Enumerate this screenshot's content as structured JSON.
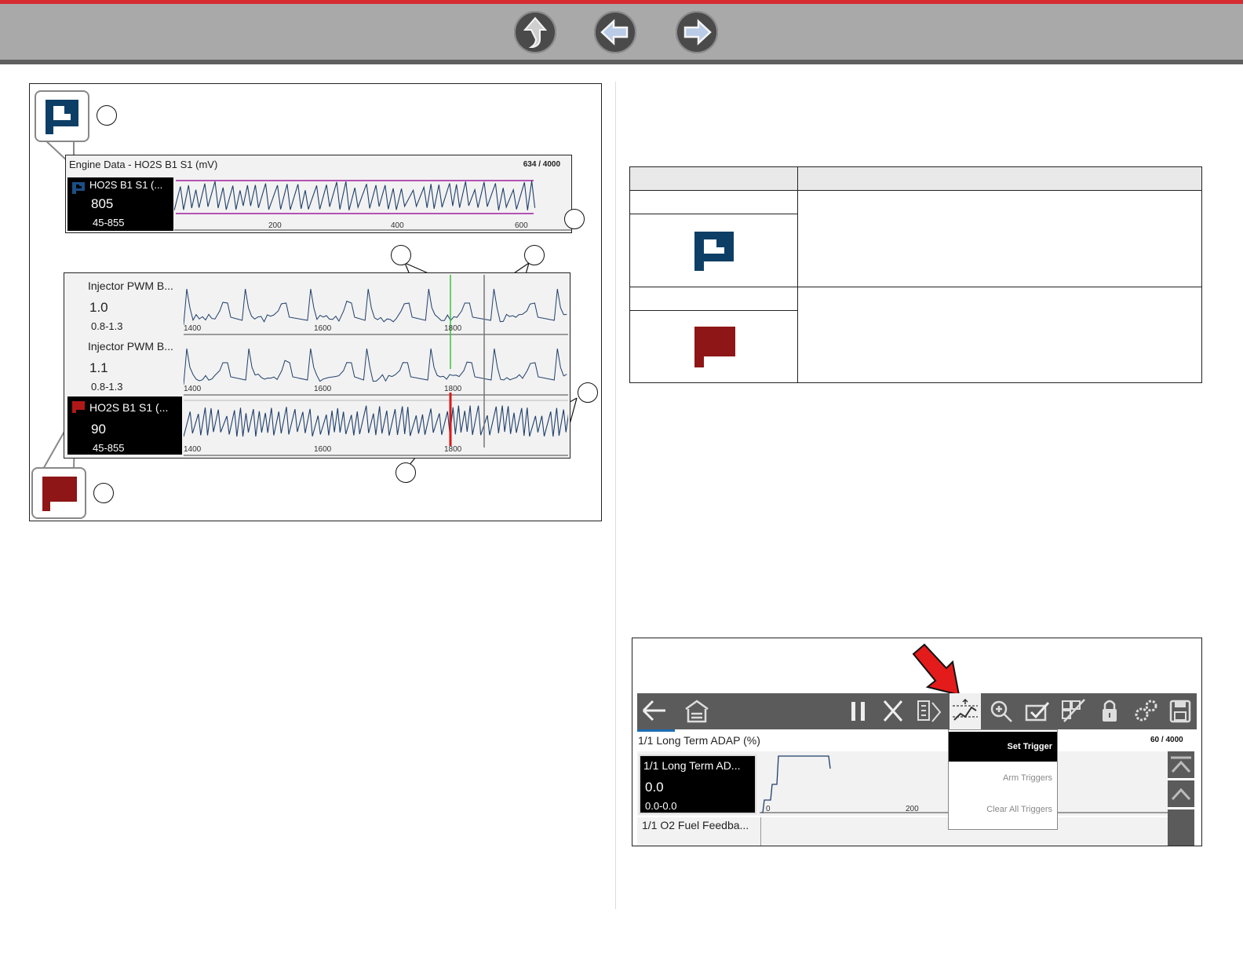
{
  "colors": {
    "brand_red": "#d72a31",
    "flag_blue": "#0d3f66",
    "flag_red": "#8e1616",
    "trace_blue": "#1f3f6b",
    "limit_magenta": "#a020a0",
    "cursor_green": "#3fbf3f",
    "trigger_red": "#d61a1a"
  },
  "nav": {
    "icons": [
      "up-arrow-icon",
      "back-arrow-icon",
      "forward-arrow-icon"
    ]
  },
  "figure1": {
    "top_graph": {
      "title": "Engine Data - HO2S B1 S1 (mV)",
      "count": "634 / 4000",
      "pid_name": "HO2S B1 S1 (...",
      "value": "805",
      "range": "45-855",
      "x_ticks": [
        "200",
        "400",
        "600"
      ]
    },
    "lower_graph": {
      "rows": [
        {
          "name": "Injector PWM B...",
          "value": "1.0",
          "range": "0.8-1.3",
          "x_ticks": [
            "1400",
            "1600",
            "1800"
          ]
        },
        {
          "name": "Injector PWM B...",
          "value": "1.1",
          "range": "0.8-1.3",
          "x_ticks": [
            "1400",
            "1600",
            "1800"
          ]
        },
        {
          "name": "HO2S B1 S1 (...",
          "value": "90",
          "range": "45-855",
          "x_ticks": [
            "1400",
            "1600",
            "1800"
          ]
        }
      ]
    }
  },
  "screenshot": {
    "title": "1/1 Long Term ADAP (%)",
    "count": "60 / 4000",
    "toolbar_icons": [
      "back-icon",
      "home-icon",
      "pause-icon",
      "close-icon",
      "filter-icon",
      "trigger-icon",
      "zoom-icon",
      "check-icon",
      "graph-view-icon",
      "lock-icon",
      "settings-icon",
      "save-icon"
    ],
    "pid1": {
      "name": "1/1 Long Term AD...",
      "value": "0.0",
      "range": "0.0-0.0",
      "x_ticks": [
        "0",
        "200"
      ]
    },
    "pid2": {
      "name": "1/1 O2 Fuel Feedba..."
    },
    "menu": [
      "Set Trigger",
      "Arm Triggers",
      "Clear All Triggers"
    ]
  }
}
